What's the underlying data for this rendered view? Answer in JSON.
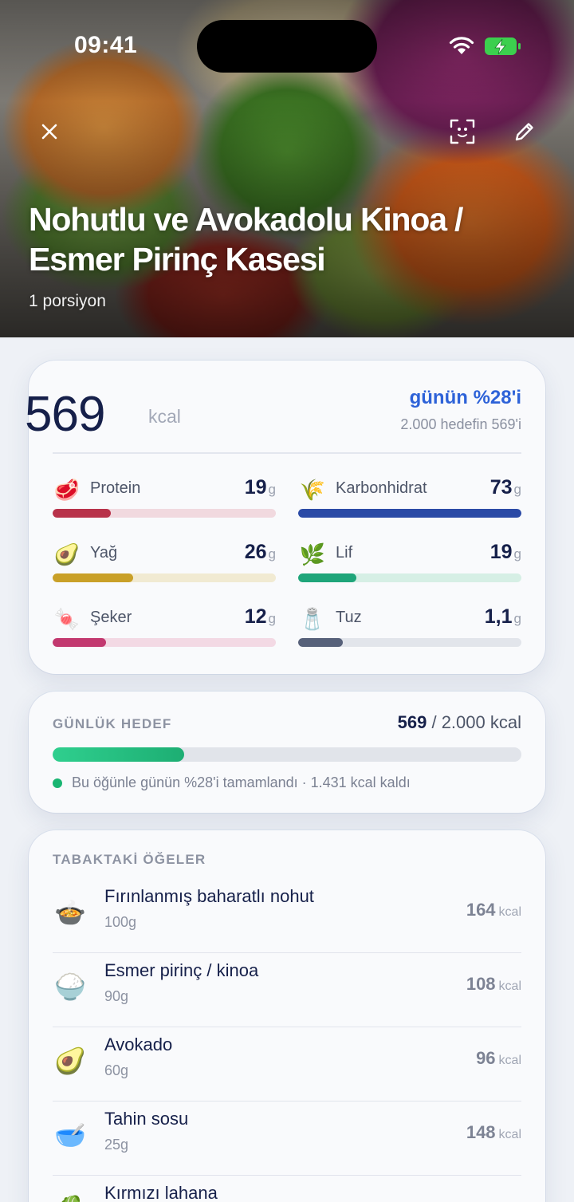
{
  "status": {
    "time": "09:41"
  },
  "hero": {
    "title": "Nohutlu ve Avokadolu Kinoa / Esmer Pirinç Kasesi",
    "portion": "1 porsiyon"
  },
  "nutrition": {
    "calories": "569",
    "calories_unit": "kcal",
    "day_percent_label": "günün %28'i",
    "day_percent_value": 28,
    "goal_text": "2.000 hedefin 569'i",
    "macros": [
      {
        "label": "Protein",
        "value": "19",
        "unit": "g",
        "icon": "meat-icon",
        "glyph": "🥩",
        "fill": 0.26,
        "color": "#b8324a",
        "track": "#f1d9df"
      },
      {
        "label": "Karbonhidrat",
        "value": "73",
        "unit": "g",
        "icon": "rice-stalk-icon",
        "glyph": "🌾",
        "fill": 1.0,
        "color": "#2b4aa6",
        "track": "#d9e1f3"
      },
      {
        "label": "Yağ",
        "value": "26",
        "unit": "g",
        "icon": "avocado-icon",
        "glyph": "🥑",
        "fill": 0.36,
        "color": "#c9a028",
        "track": "#f1ead2"
      },
      {
        "label": "Lif",
        "value": "19",
        "unit": "g",
        "icon": "herb-icon",
        "glyph": "🌿",
        "fill": 0.26,
        "color": "#1fa57a",
        "track": "#d6efe5"
      },
      {
        "label": "Şeker",
        "value": "12",
        "unit": "g",
        "icon": "candy-icon",
        "glyph": "🍬",
        "fill": 0.24,
        "color": "#c2386f",
        "track": "#f3d9e4"
      },
      {
        "label": "Tuz",
        "value": "1,1",
        "unit": "g",
        "icon": "salt-shaker-icon",
        "glyph": "🧂",
        "fill": 0.2,
        "color": "#57617a",
        "track": "#e2e5eb"
      }
    ]
  },
  "daily_goal": {
    "label": "GÜNLÜK HEDEF",
    "current": "569",
    "rest": " / 2.000 kcal",
    "progress": 0.28,
    "note": "Bu öğünle günün %28'i tamamlandı · 1.431 kcal kaldı"
  },
  "items": {
    "label": "TABAKTAKİ ÖĞELER",
    "list": [
      {
        "name": "Fırınlanmış baharatlı nohut",
        "qty": "100g",
        "kcal": "164",
        "unit": "kcal",
        "icon": "chickpea-plate-icon",
        "glyph": "🍲"
      },
      {
        "name": "Esmer pirinç / kinoa",
        "qty": "90g",
        "kcal": "108",
        "unit": "kcal",
        "icon": "rice-bowl-icon",
        "glyph": "🍚"
      },
      {
        "name": "Avokado",
        "qty": "60g",
        "kcal": "96",
        "unit": "kcal",
        "icon": "avocado-icon",
        "glyph": "🥑"
      },
      {
        "name": "Tahin sosu",
        "qty": "25g",
        "kcal": "148",
        "unit": "kcal",
        "icon": "sauce-bowl-icon",
        "glyph": "🥣"
      },
      {
        "name": "Kırmızı lahana",
        "qty": "",
        "kcal": "",
        "unit": "",
        "icon": "cabbage-icon",
        "glyph": "🥬"
      }
    ]
  }
}
